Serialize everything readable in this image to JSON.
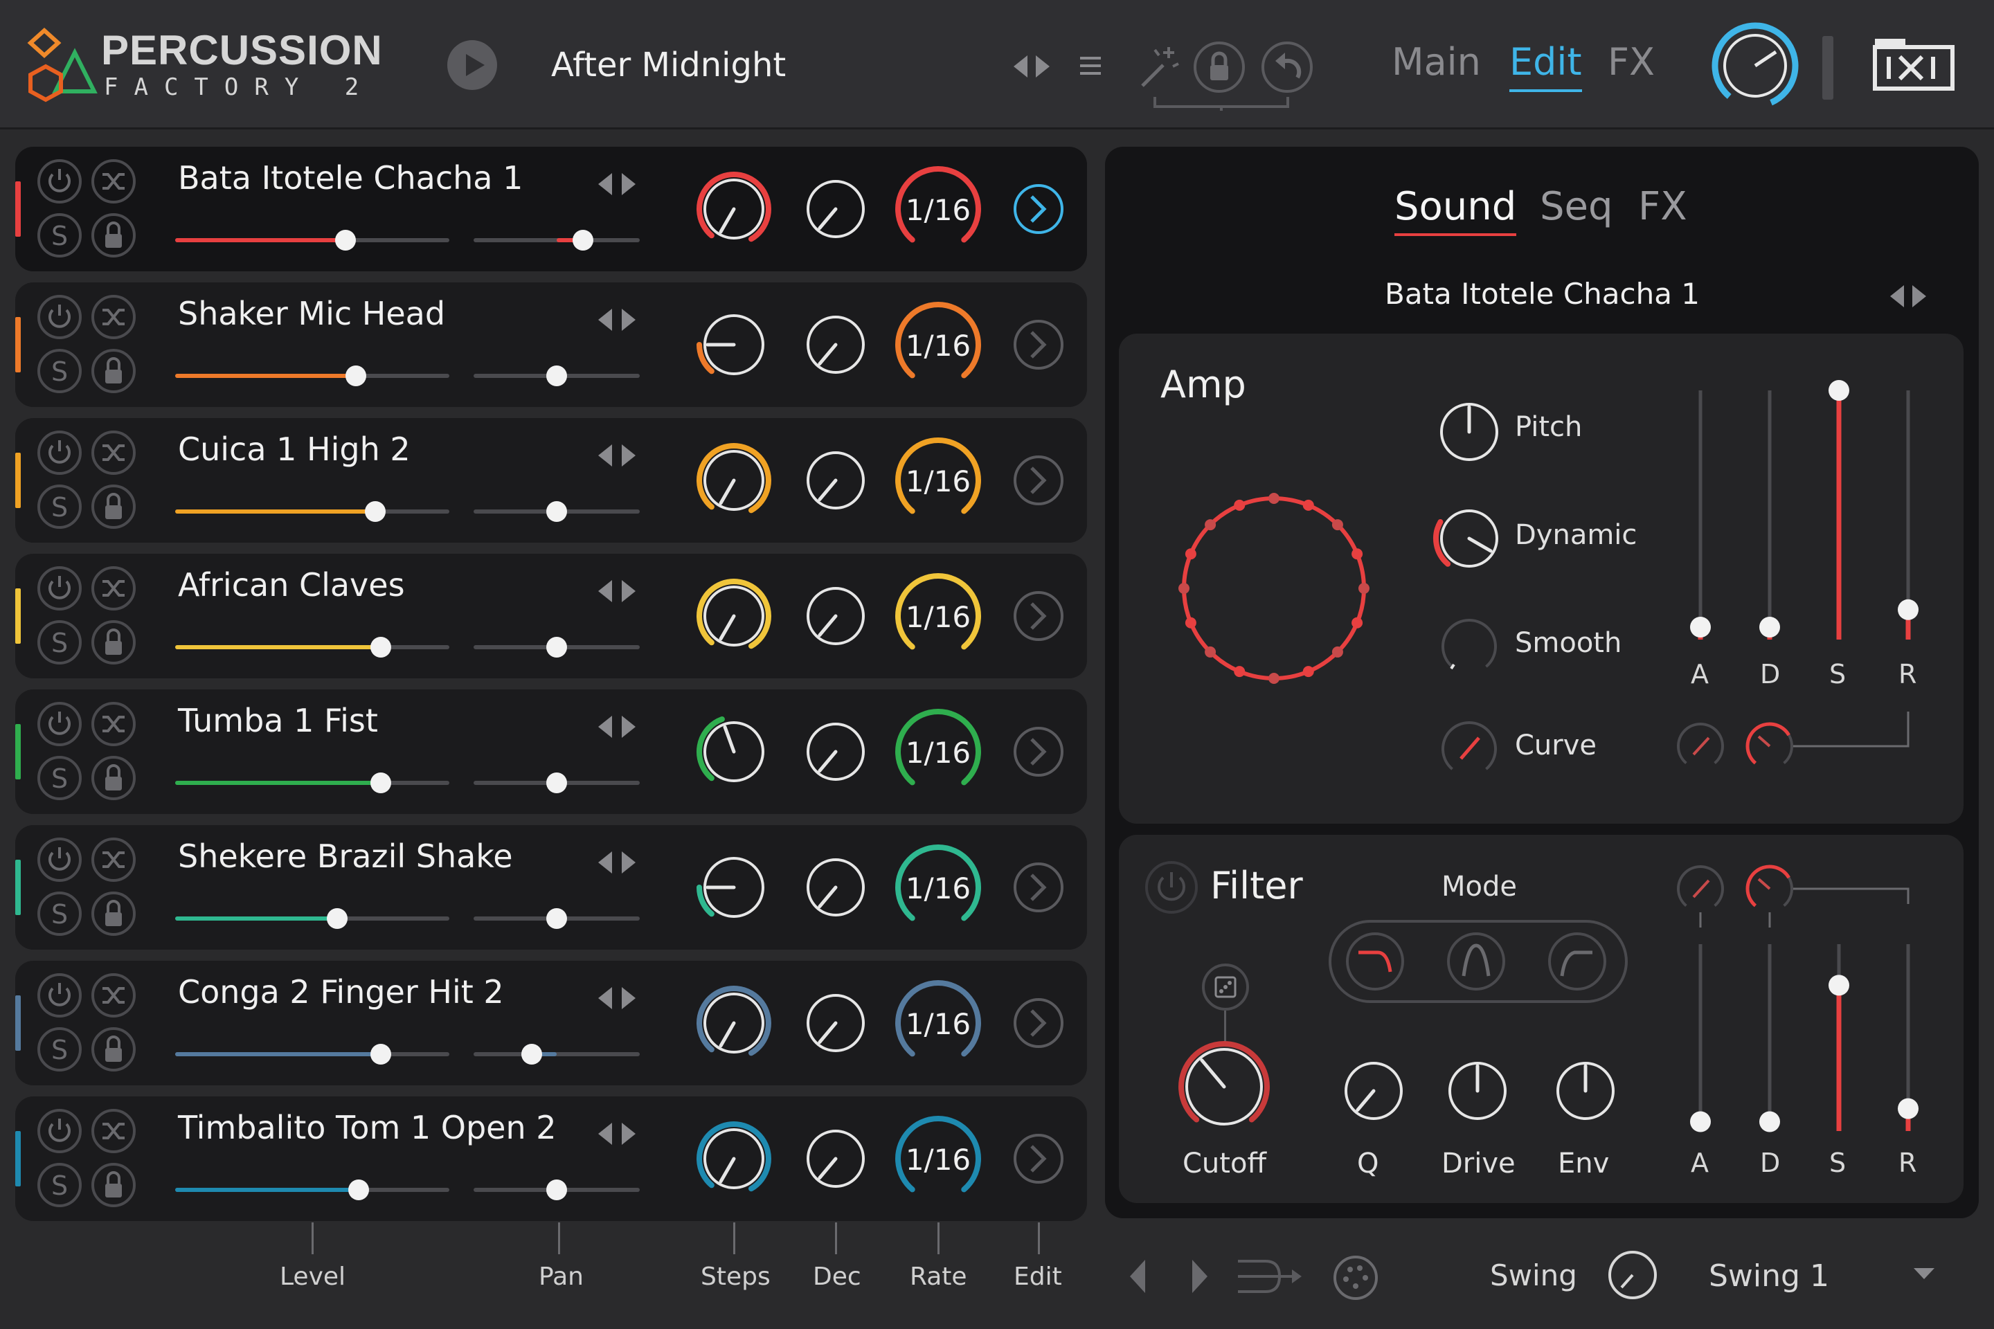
{
  "app": {
    "brand_title": "PERCUSSION",
    "brand_subtitle": "FACTORY 2",
    "preset_name": "After Midnight",
    "nav_tabs": [
      "Main",
      "Edit",
      "FX"
    ],
    "active_nav": "Edit"
  },
  "colors": {
    "accent_blue": "#3fb5e8",
    "accent_red": "#e84040"
  },
  "tracks": [
    {
      "name": "Bata Itotele Chacha 1",
      "color": "#e84040",
      "level": 0.62,
      "pan": 0.66,
      "steps": "1/16",
      "selected": true
    },
    {
      "name": "Shaker Mic Head",
      "color": "#ee7a2a",
      "level": 0.66,
      "pan": 0.5,
      "steps": "1/16",
      "selected": false
    },
    {
      "name": "Cuica 1 High 2",
      "color": "#f0a224",
      "level": 0.73,
      "pan": 0.5,
      "steps": "1/16",
      "selected": false
    },
    {
      "name": "African Claves",
      "color": "#f0c53a",
      "level": 0.75,
      "pan": 0.5,
      "steps": "1/16",
      "selected": false
    },
    {
      "name": "Tumba 1 Fist",
      "color": "#2fae4e",
      "level": 0.75,
      "pan": 0.5,
      "steps": "1/16",
      "selected": false
    },
    {
      "name": "Shekere Brazil Shake",
      "color": "#2fb890",
      "level": 0.59,
      "pan": 0.5,
      "steps": "1/16",
      "selected": false
    },
    {
      "name": "Conga 2 Finger Hit 2",
      "color": "#557a9e",
      "level": 0.75,
      "pan": 0.35,
      "steps": "1/16",
      "selected": false
    },
    {
      "name": "Timbalito Tom 1 Open 2",
      "color": "#1e8ab0",
      "level": 0.67,
      "pan": 0.5,
      "steps": "1/16",
      "selected": false
    }
  ],
  "track_buttons": {
    "solo": "S"
  },
  "right": {
    "sub_tabs": [
      "Sound",
      "Seq",
      "FX"
    ],
    "active_sub_tab": "Sound",
    "instrument_name": "Bata Itotele Chacha 1",
    "amp": {
      "title": "Amp",
      "knobs": [
        "Pitch",
        "Dynamic",
        "Smooth",
        "Curve"
      ],
      "env_labels": [
        "A",
        "D",
        "S",
        "R"
      ],
      "env_values": [
        0.05,
        0.05,
        1.0,
        0.12
      ]
    },
    "filter": {
      "title": "Filter",
      "mode_label": "Mode",
      "knobs": [
        "Cutoff",
        "Q",
        "Drive",
        "Env"
      ],
      "env_labels": [
        "A",
        "D",
        "S",
        "R"
      ],
      "env_values": [
        0.05,
        0.05,
        0.78,
        0.12
      ]
    }
  },
  "footer": {
    "col_labels": [
      "Level",
      "Pan",
      "Steps",
      "Dec",
      "Rate",
      "Edit"
    ],
    "swing_label": "Swing",
    "swing_preset": "Swing 1"
  }
}
